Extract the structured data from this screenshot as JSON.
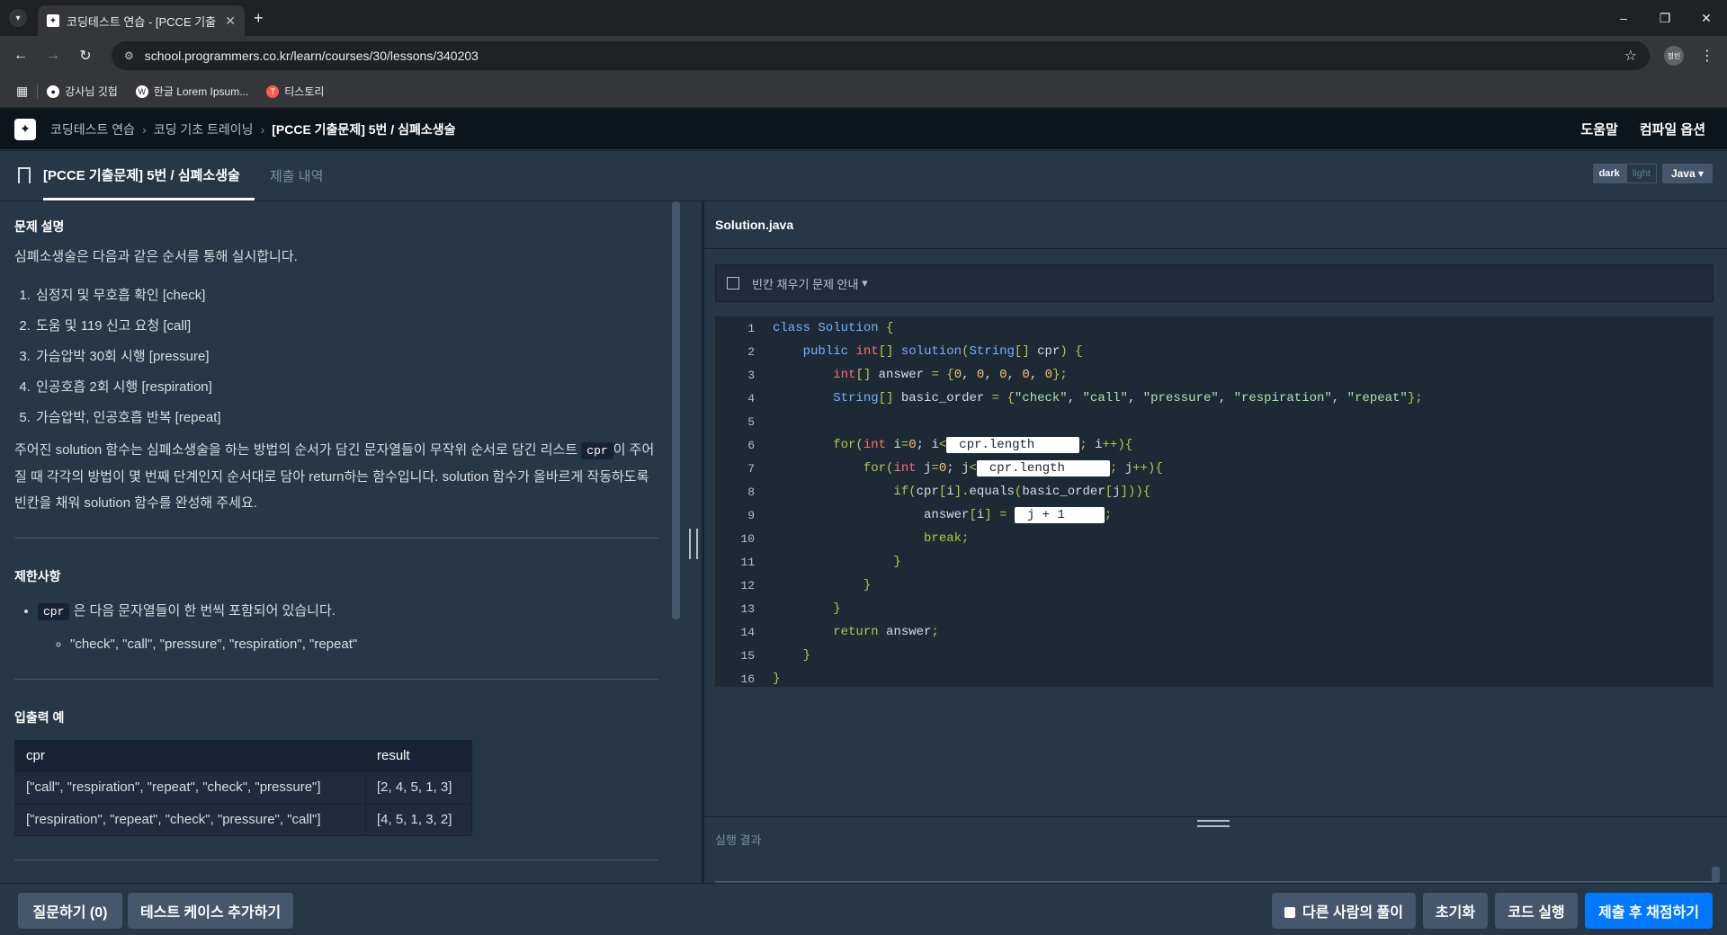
{
  "browser": {
    "tab_title": "코딩테스트 연습 - [PCCE 기출",
    "url": "school.programmers.co.kr/learn/courses/30/lessons/340203",
    "profile_label": "정빈",
    "bookmarks": [
      {
        "label": "강사님 깃헙",
        "icon": "github-icon",
        "color": "#ffffff"
      },
      {
        "label": "한글 Lorem Ipsum...",
        "icon": "wordpress-icon",
        "color": "#ffffff"
      },
      {
        "label": "티스토리",
        "icon": "tistory-icon",
        "color": "#ff5a4a"
      }
    ]
  },
  "header": {
    "breadcrumbs": [
      "코딩테스트 연습",
      "코딩 기초 트레이닝",
      "[PCCE 기출문제] 5번 / 심폐소생술"
    ],
    "help": "도움말",
    "compile_options": "컴파일 옵션"
  },
  "tabs": {
    "problem": "[PCCE 기출문제] 5번 / 심폐소생술",
    "submissions": "제출 내역",
    "theme_dark": "dark",
    "theme_light": "light",
    "language": "Java"
  },
  "problem": {
    "desc_title": "문제 설명",
    "intro": "심폐소생술은 다음과 같은 순서를 통해 실시합니다.",
    "steps": [
      "심정지 및 무호흡 확인 [check]",
      "도움 및 119 신고 요청 [call]",
      "가슴압박 30회 시행 [pressure]",
      "인공호흡 2회 시행 [respiration]",
      "가슴압박, 인공호흡 반복 [repeat]"
    ],
    "para_before": "주어진 solution 함수는 심폐소생술을 하는 방법의 순서가 담긴 문자열들이 무작위 순서로 담긴 리스트 ",
    "para_code": "cpr",
    "para_after": "이 주어질 때 각각의 방법이 몇 번째 단계인지 순서대로 담아 return하는 함수입니다. solution 함수가 올바르게 작동하도록 빈칸을 채워 solution 함수를 완성해 주세요.",
    "constraints_title": "제한사항",
    "constraint_code": "cpr",
    "constraint_text": " 은 다음 문자열들이 한 번씩 포함되어 있습니다.",
    "constraint_sub": "\"check\", \"call\", \"pressure\", \"respiration\", \"repeat\"",
    "io_title": "입출력 예",
    "io_headers": [
      "cpr",
      "result"
    ],
    "io_rows": [
      [
        "[\"call\", \"respiration\", \"repeat\", \"check\", \"pressure\"]",
        "[2, 4, 5, 1, 3]"
      ],
      [
        "[\"respiration\", \"repeat\", \"check\", \"pressure\", \"call\"]",
        "[4, 5, 1, 3, 2]"
      ]
    ]
  },
  "editor": {
    "file_name": "Solution.java",
    "guide": "빈칸 채우기 문제 안내",
    "blanks": [
      "cpr.length",
      "cpr.length",
      "j + 1"
    ],
    "line_numbers": [
      "1",
      "2",
      "3",
      "4",
      "5",
      "6",
      "7",
      "8",
      "9",
      "10",
      "11",
      "12",
      "13",
      "14",
      "15",
      "16"
    ],
    "result_label": "실행 결과"
  },
  "footer": {
    "ask": "질문하기 (0)",
    "add_test": "테스트 케이스 추가하기",
    "others": "다른 사람의 풀이",
    "reset": "초기화",
    "run": "코드 실행",
    "submit": "제출 후 채점하기"
  }
}
